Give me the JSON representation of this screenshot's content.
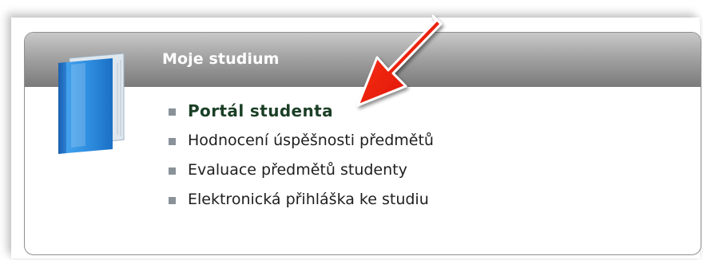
{
  "panel": {
    "title": "Moje studium",
    "icon": "blue-book-icon",
    "links": [
      {
        "label": "Portál studenta",
        "emphasis": true
      },
      {
        "label": "Hodnocení úspěšnosti předmětů",
        "emphasis": false
      },
      {
        "label": "Evaluace předmětů studenty",
        "emphasis": false
      },
      {
        "label": "Elektronická přihláška ke studiu",
        "emphasis": false
      }
    ]
  },
  "annotation": {
    "type": "red-arrow-icon",
    "color": "#e8120c",
    "points_to": "Portál studenta"
  },
  "colors": {
    "header_gradient_top": "#c9c9c9",
    "header_gradient_bottom": "#7a7a7a",
    "primary_link": "#1b3f26",
    "bullet": "#8a9299"
  }
}
